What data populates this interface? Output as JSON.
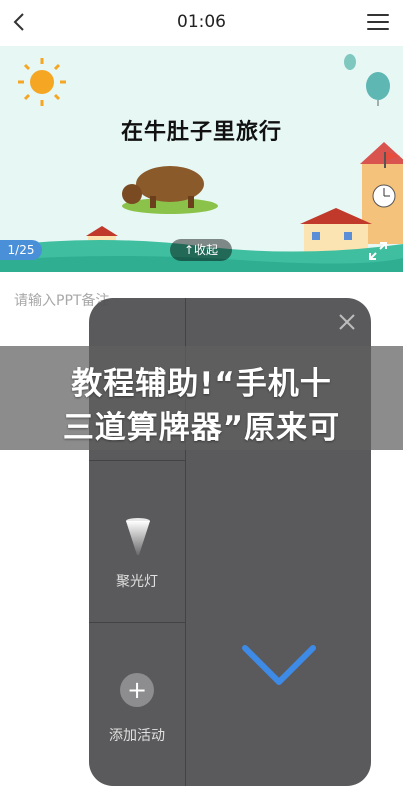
{
  "header": {
    "time": "01:06"
  },
  "slide": {
    "title": "在牛肚子里旅行",
    "counter": "1/25",
    "collapse_label": "↑收起"
  },
  "notes": {
    "placeholder": "请输入PPT备注"
  },
  "panel": {
    "tools": [
      {
        "label": "聚光灯",
        "icon": "spotlight-icon"
      },
      {
        "label": "添加活动",
        "icon": "add-icon"
      }
    ]
  },
  "banner": {
    "line1": "教程辅助!“手机十",
    "line2": "三道算牌器”原来可"
  }
}
